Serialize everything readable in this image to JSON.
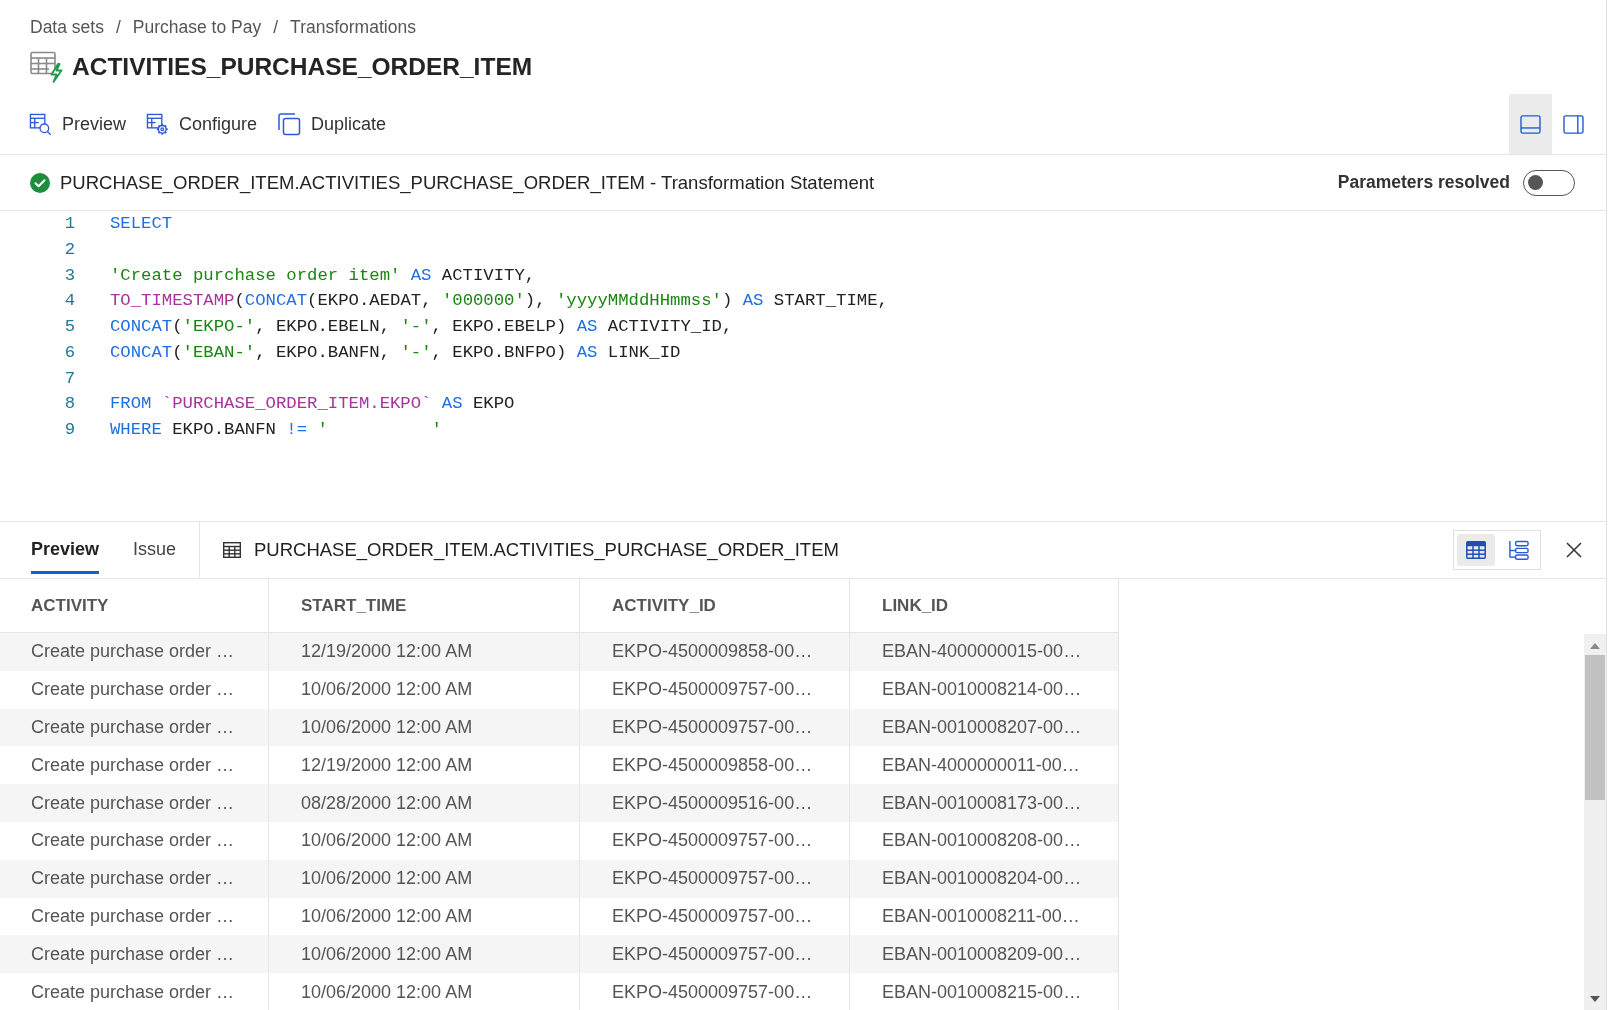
{
  "breadcrumb": [
    {
      "label": "Data sets",
      "separator": "/"
    },
    {
      "label": "Purchase to Pay",
      "separator": "/"
    },
    {
      "label": "Transformations"
    }
  ],
  "title": "ACTIVITIES_PURCHASE_ORDER_ITEM",
  "toolbar": [
    {
      "kind": "preview",
      "label": "Preview"
    },
    {
      "kind": "configure",
      "label": "Configure"
    },
    {
      "kind": "duplicate",
      "label": "Duplicate"
    }
  ],
  "layout_toggle": [
    {
      "kind": "bottom_panel",
      "selected": true
    },
    {
      "kind": "side_panel",
      "selected": false
    }
  ],
  "statement": {
    "succeeded": true,
    "title": "PURCHASE_ORDER_ITEM.ACTIVITIES_PURCHASE_ORDER_ITEM - Transformation Statement",
    "parameters_toggle": {
      "label": "Parameters resolved",
      "on": false
    },
    "lines": [
      {
        "number": "1",
        "tokens": [
          {
            "kind": "keyword",
            "text": "SELECT"
          }
        ]
      },
      {
        "number": "2"
      },
      {
        "number": "3",
        "tokens": [
          {
            "kind": "string",
            "text": "'Create purchase order item'"
          },
          {
            "kind": "keyword",
            "text": " AS"
          },
          {
            "kind": "plain",
            "text": " ACTIVITY,"
          }
        ]
      },
      {
        "number": "4",
        "tokens": [
          {
            "kind": "special",
            "text": "TO_TIMESTAMP"
          },
          {
            "kind": "plain",
            "text": "("
          },
          {
            "kind": "keyword",
            "text": "CONCAT"
          },
          {
            "kind": "plain",
            "text": "(EKPO.AEDAT, "
          },
          {
            "kind": "string",
            "text": "'000000'"
          },
          {
            "kind": "plain",
            "text": "), "
          },
          {
            "kind": "string",
            "text": "'yyyyMMddHHmmss'"
          },
          {
            "kind": "plain",
            "text": ")"
          },
          {
            "kind": "keyword",
            "text": " AS"
          },
          {
            "kind": "plain",
            "text": " START_TIME,"
          }
        ]
      },
      {
        "number": "5",
        "tokens": [
          {
            "kind": "keyword",
            "text": "CONCAT"
          },
          {
            "kind": "plain",
            "text": "("
          },
          {
            "kind": "string",
            "text": "'EKPO-'"
          },
          {
            "kind": "plain",
            "text": ", EKPO.EBELN, "
          },
          {
            "kind": "string",
            "text": "'-'"
          },
          {
            "kind": "plain",
            "text": ", EKPO.EBELP)"
          },
          {
            "kind": "keyword",
            "text": " AS"
          },
          {
            "kind": "plain",
            "text": " ACTIVITY_ID,"
          }
        ]
      },
      {
        "number": "6",
        "tokens": [
          {
            "kind": "keyword",
            "text": "CONCAT"
          },
          {
            "kind": "plain",
            "text": "("
          },
          {
            "kind": "string",
            "text": "'EBAN-'"
          },
          {
            "kind": "plain",
            "text": ", EKPO.BANFN, "
          },
          {
            "kind": "string",
            "text": "'-'"
          },
          {
            "kind": "plain",
            "text": ", EKPO.BNFPO)"
          },
          {
            "kind": "keyword",
            "text": " AS"
          },
          {
            "kind": "plain",
            "text": " LINK_ID"
          }
        ]
      },
      {
        "number": "7"
      },
      {
        "number": "8",
        "tokens": [
          {
            "kind": "keyword",
            "text": "FROM"
          },
          {
            "kind": "special",
            "text": " `PURCHASE_ORDER_ITEM.EKPO`"
          },
          {
            "kind": "keyword",
            "text": " AS"
          },
          {
            "kind": "plain",
            "text": " EKPO"
          }
        ]
      },
      {
        "number": "9",
        "tokens": [
          {
            "kind": "keyword",
            "text": "WHERE"
          },
          {
            "kind": "plain",
            "text": " EKPO.BANFN"
          },
          {
            "kind": "keyword",
            "text": " !="
          },
          {
            "kind": "string",
            "text": " '          '"
          }
        ]
      }
    ]
  },
  "bottom_panel": {
    "tabs": [
      {
        "label": "Preview",
        "selected": true
      },
      {
        "label": "Issue",
        "selected": false
      }
    ],
    "table_name": "PURCHASE_ORDER_ITEM.ACTIVITIES_PURCHASE_ORDER_ITEM",
    "view_toggle": [
      {
        "kind": "grid",
        "selected": true
      },
      {
        "kind": "tree",
        "selected": false
      }
    ],
    "table": {
      "columns": [
        "ACTIVITY",
        "START_TIME",
        "ACTIVITY_ID",
        "LINK_ID"
      ],
      "rows": [
        [
          "Create purchase order …",
          "12/19/2000 12:00 AM",
          "EKPO-4500009858-00…",
          "EBAN-4000000015-00…"
        ],
        [
          "Create purchase order …",
          "10/06/2000 12:00 AM",
          "EKPO-4500009757-00…",
          "EBAN-0010008214-00…"
        ],
        [
          "Create purchase order …",
          "10/06/2000 12:00 AM",
          "EKPO-4500009757-00…",
          "EBAN-0010008207-00…"
        ],
        [
          "Create purchase order …",
          "12/19/2000 12:00 AM",
          "EKPO-4500009858-00…",
          "EBAN-4000000011-00…"
        ],
        [
          "Create purchase order …",
          "08/28/2000 12:00 AM",
          "EKPO-4500009516-00…",
          "EBAN-0010008173-00…"
        ],
        [
          "Create purchase order …",
          "10/06/2000 12:00 AM",
          "EKPO-4500009757-00…",
          "EBAN-0010008208-00…"
        ],
        [
          "Create purchase order …",
          "10/06/2000 12:00 AM",
          "EKPO-4500009757-00…",
          "EBAN-0010008204-00…"
        ],
        [
          "Create purchase order …",
          "10/06/2000 12:00 AM",
          "EKPO-4500009757-00…",
          "EBAN-0010008211-00…"
        ],
        [
          "Create purchase order …",
          "10/06/2000 12:00 AM",
          "EKPO-4500009757-00…",
          "EBAN-0010008209-00…"
        ],
        [
          "Create purchase order …",
          "10/06/2000 12:00 AM",
          "EKPO-4500009757-00…",
          "EBAN-0010008215-00…"
        ]
      ]
    }
  }
}
